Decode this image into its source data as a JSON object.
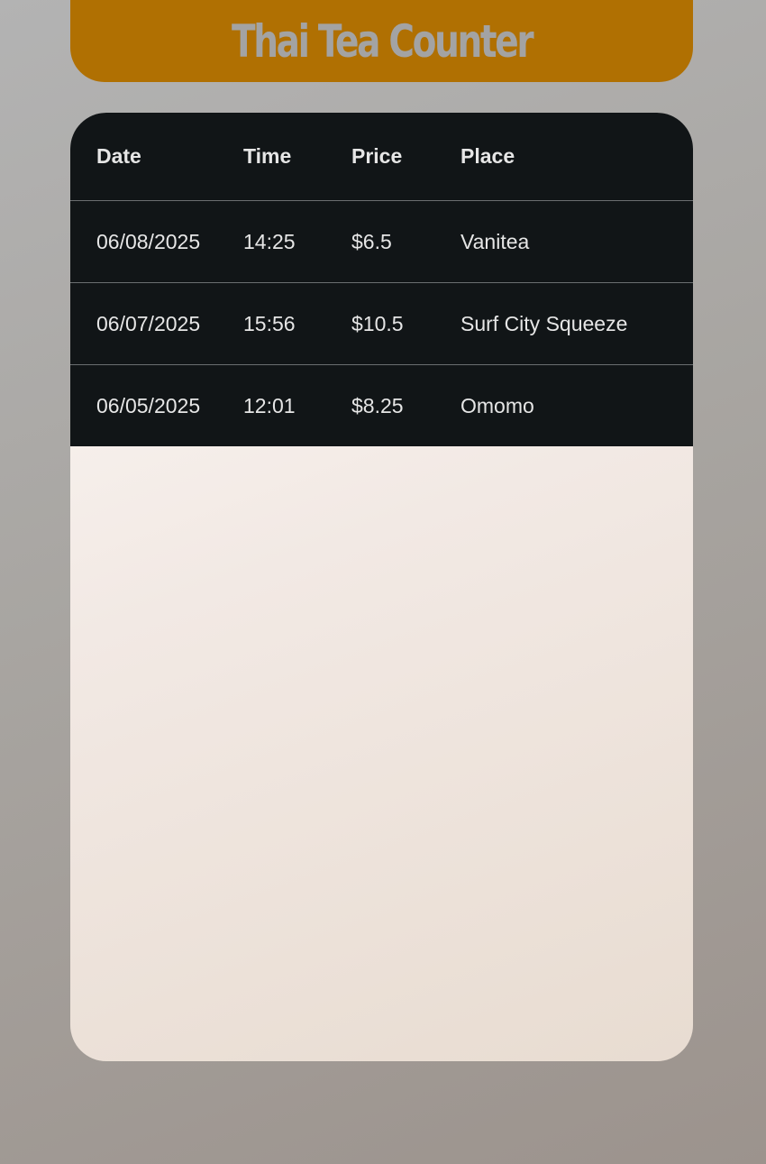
{
  "header": {
    "title": "Thai Tea Counter"
  },
  "table": {
    "columns": [
      "Date",
      "Time",
      "Price",
      "Place"
    ],
    "rows": [
      {
        "date": "06/08/2025",
        "time": "14:25",
        "price": "$6.5",
        "place": "Vanitea"
      },
      {
        "date": "06/07/2025",
        "time": "15:56",
        "price": "$10.5",
        "place": "Surf City Squeeze"
      },
      {
        "date": "06/05/2025",
        "time": "12:01",
        "price": "$8.25",
        "place": "Omomo"
      }
    ]
  },
  "colors": {
    "header_bg": "#b07002",
    "header_text": "#a3a3a3",
    "table_bg": "#111517",
    "table_text": "#e6e6e6"
  }
}
